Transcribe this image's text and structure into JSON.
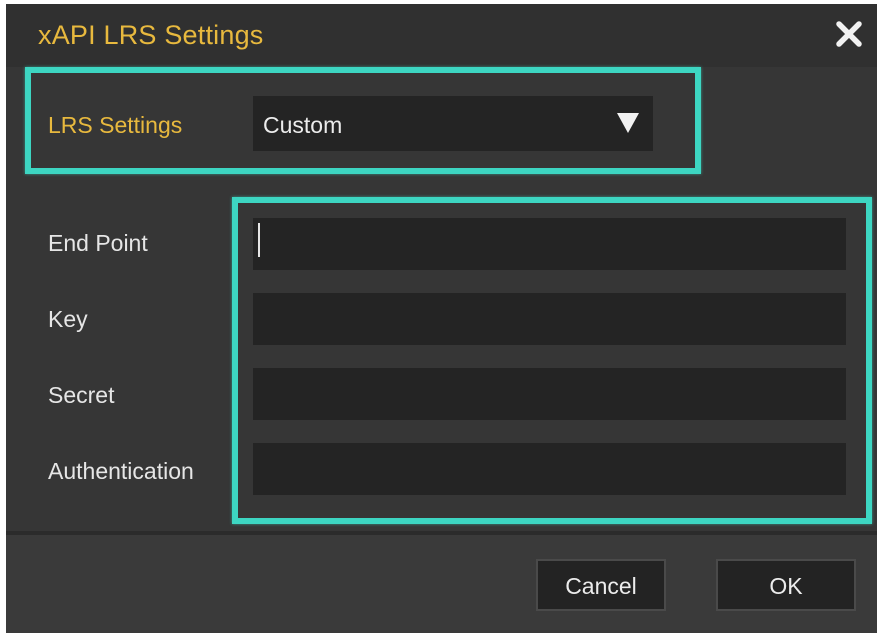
{
  "dialog": {
    "title": "xAPI LRS Settings",
    "close_icon": "close-icon"
  },
  "lrs_settings": {
    "label": "LRS Settings",
    "selected": "Custom",
    "arrow_icon": "dropdown-triangle-icon"
  },
  "fields": {
    "end_point": {
      "label": "End Point",
      "value": ""
    },
    "key": {
      "label": "Key",
      "value": ""
    },
    "secret": {
      "label": "Secret",
      "value": ""
    },
    "authentication": {
      "label": "Authentication",
      "value": ""
    }
  },
  "footer": {
    "cancel_label": "Cancel",
    "ok_label": "OK"
  },
  "colors": {
    "accent": "#e8b93e",
    "highlight": "#3dd6c2",
    "background": "#363636",
    "input_background": "#242424"
  }
}
